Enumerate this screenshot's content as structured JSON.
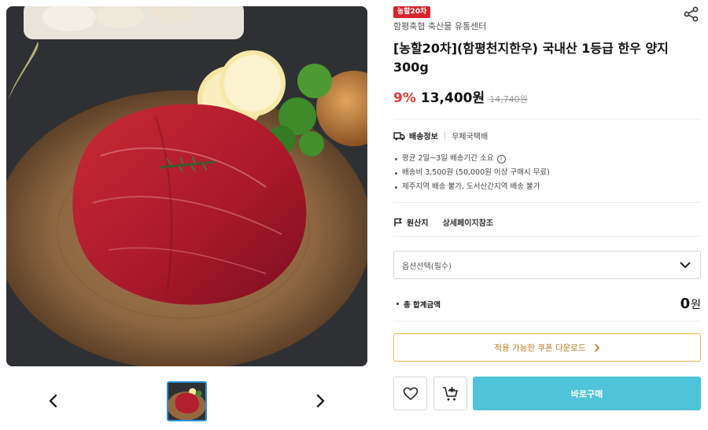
{
  "product": {
    "badge": "농할20차",
    "seller": "함평축협 축산물 유통센터",
    "title": "[농할20차](함평천지한우) 국내산 1등급 한우 양지 300g",
    "discount": "9%",
    "price": "13,400원",
    "original_price": "14,740원"
  },
  "shipping": {
    "label": "배송정보",
    "value": "우체국택배",
    "notes": [
      "평균 2일~3일 배송기간 소요",
      "배송비 3,500원 (50,000원 이상 구매시 무료)",
      "제주지역 배송 불가, 도서산간지역 배송 불가"
    ]
  },
  "origin": {
    "label": "원산지",
    "value": "상세페이지참조"
  },
  "option_select": {
    "placeholder": "옵션선택(필수)"
  },
  "total": {
    "label": "총 합계금액",
    "amount": "0",
    "unit": "원"
  },
  "coupon": {
    "label": "적용 가능한 쿠폰 다운로드"
  },
  "actions": {
    "buy_now": "바로구매"
  },
  "icons": {
    "share": "share-icon",
    "truck": "truck-icon",
    "flag": "flag-icon",
    "info": "info-icon",
    "chevron_down": "chevron-down-icon",
    "chevron_right": "chevron-right-icon",
    "heart": "heart-icon",
    "cart_add": "cart-add-icon",
    "prev": "chevron-left-icon",
    "next": "chevron-right-icon"
  },
  "colors": {
    "badge_bg": "#d7262e",
    "discount": "#e03a35",
    "coupon_border": "#e8b64a",
    "coupon_text": "#b7791f",
    "buy_button": "#4fc3d7",
    "thumb_active_border": "#2a8fd6"
  }
}
